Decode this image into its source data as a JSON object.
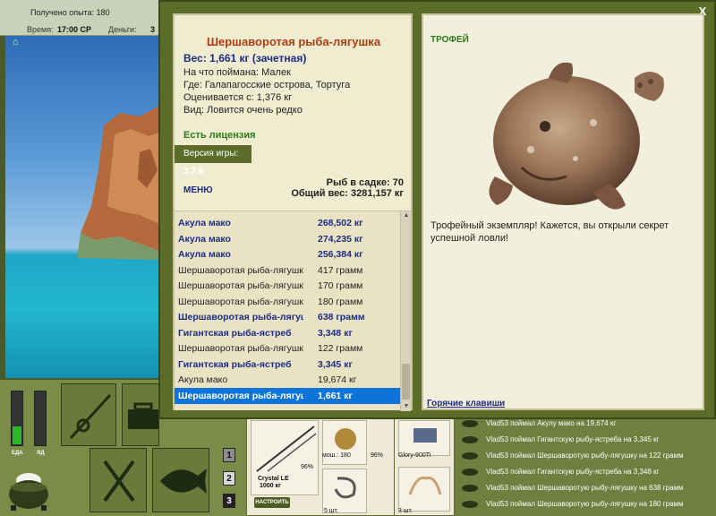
{
  "topbar": {
    "experience": "Получено опыта: 180",
    "time_label": "Время:",
    "time_value": "17:00 СР",
    "money_label": "Деньги:",
    "money_value": "3"
  },
  "meters": {
    "food_label": "ЕДА",
    "poison_label": "ЯД",
    "food_level": 0.35,
    "poison_level": 0.0
  },
  "tabs": [
    "1",
    "2",
    "3"
  ],
  "tackle": {
    "rod_name": "Crystal LE",
    "rod_weight": "1000 кг",
    "rod_pct": "96%",
    "reel_pct": "96%",
    "bait_label": "мош.: 180",
    "line_name": "Glory-900Ti",
    "hook_count": "5 шт.",
    "lure_count": "3 шт.",
    "setup_button": "НАСТРОИТЬ"
  },
  "log": [
    "Vlad53 поймал Акулу мако на 19,674 кг",
    "Vlad53 поймал Гигантскую рыбу-ястреба на 3,345 кг",
    "Vlad53 поймал Шершаворотую рыбу-лягушку на 122 грамм",
    "Vlad53 поймал Гигантскую рыбу-ястреба на 3,348 кг",
    "Vlad53 поймал Шершаворотую рыбу-лягушку на 638 грамм",
    "Vlad53 поймал Шершаворотую рыбу-лягушку на 180 грамм"
  ],
  "dialog": {
    "close_label": "X",
    "fish_title": "Шершаворотая рыба-лягушка",
    "fish_weight": "Вес: 1,661 кг (зачетная)",
    "caught_on": "На что поймана: Малек",
    "where": "Где: Галапагосские острова, Тортуга",
    "rated_from": "Оценивается с: 1,376 кг",
    "kind": "Вид: Ловится очень редко",
    "license": "Есть лицензия",
    "version_label": "Версия игры: ",
    "version_value": "3.7.6",
    "menu_label": "МЕНЮ",
    "keep_count": "Рыб в садке: 70",
    "keep_weight": "Общий вес: 3281,157 кг",
    "trophy_label": "ТРОФЕЙ",
    "trophy_text": "Трофейный экземпляр! Кажется, вы открыли секрет успешной ловли!",
    "hotkeys": "Горячие клавиши"
  },
  "catch_list": [
    {
      "name": "Акула мако",
      "weight": "268,502 кг",
      "style": "trophy"
    },
    {
      "name": "Акула мако",
      "weight": "274,235 кг",
      "style": "trophy"
    },
    {
      "name": "Акула мако",
      "weight": "256,384 кг",
      "style": "trophy"
    },
    {
      "name": "Шершаворотая рыба-лягушка",
      "weight": "417 грамм",
      "style": "normal"
    },
    {
      "name": "Шершаворотая рыба-лягушка",
      "weight": "170 грамм",
      "style": "normal"
    },
    {
      "name": "Шершаворотая рыба-лягушка",
      "weight": "180 грамм",
      "style": "normal"
    },
    {
      "name": "Шершаворотая рыба-лягушка",
      "weight": "638 грамм",
      "style": "trophy"
    },
    {
      "name": "Гигантская рыба-ястреб",
      "weight": "3,348 кг",
      "style": "trophy"
    },
    {
      "name": "Шершаворотая рыба-лягушка",
      "weight": "122 грамм",
      "style": "normal"
    },
    {
      "name": "Гигантская рыба-ястреб",
      "weight": "3,345 кг",
      "style": "trophy"
    },
    {
      "name": "Акула мако",
      "weight": "19,674 кг",
      "style": "normal"
    },
    {
      "name": "Шершаворотая рыба-лягушка",
      "weight": "1,661 кг",
      "style": "selected"
    }
  ],
  "colors": {
    "title_red": "#b23a12",
    "trophy_blue": "#1c2c86",
    "selection_blue": "#0a74d8",
    "panel_green": "#5c6d2a",
    "license_green": "#2b7a1a"
  },
  "icons": [
    "home-icon",
    "rod-icon",
    "tackle-box-icon",
    "fork-knife-icon",
    "fish-icon",
    "pot-icon",
    "close-icon",
    "scroll-up-icon",
    "scroll-down-icon"
  ]
}
